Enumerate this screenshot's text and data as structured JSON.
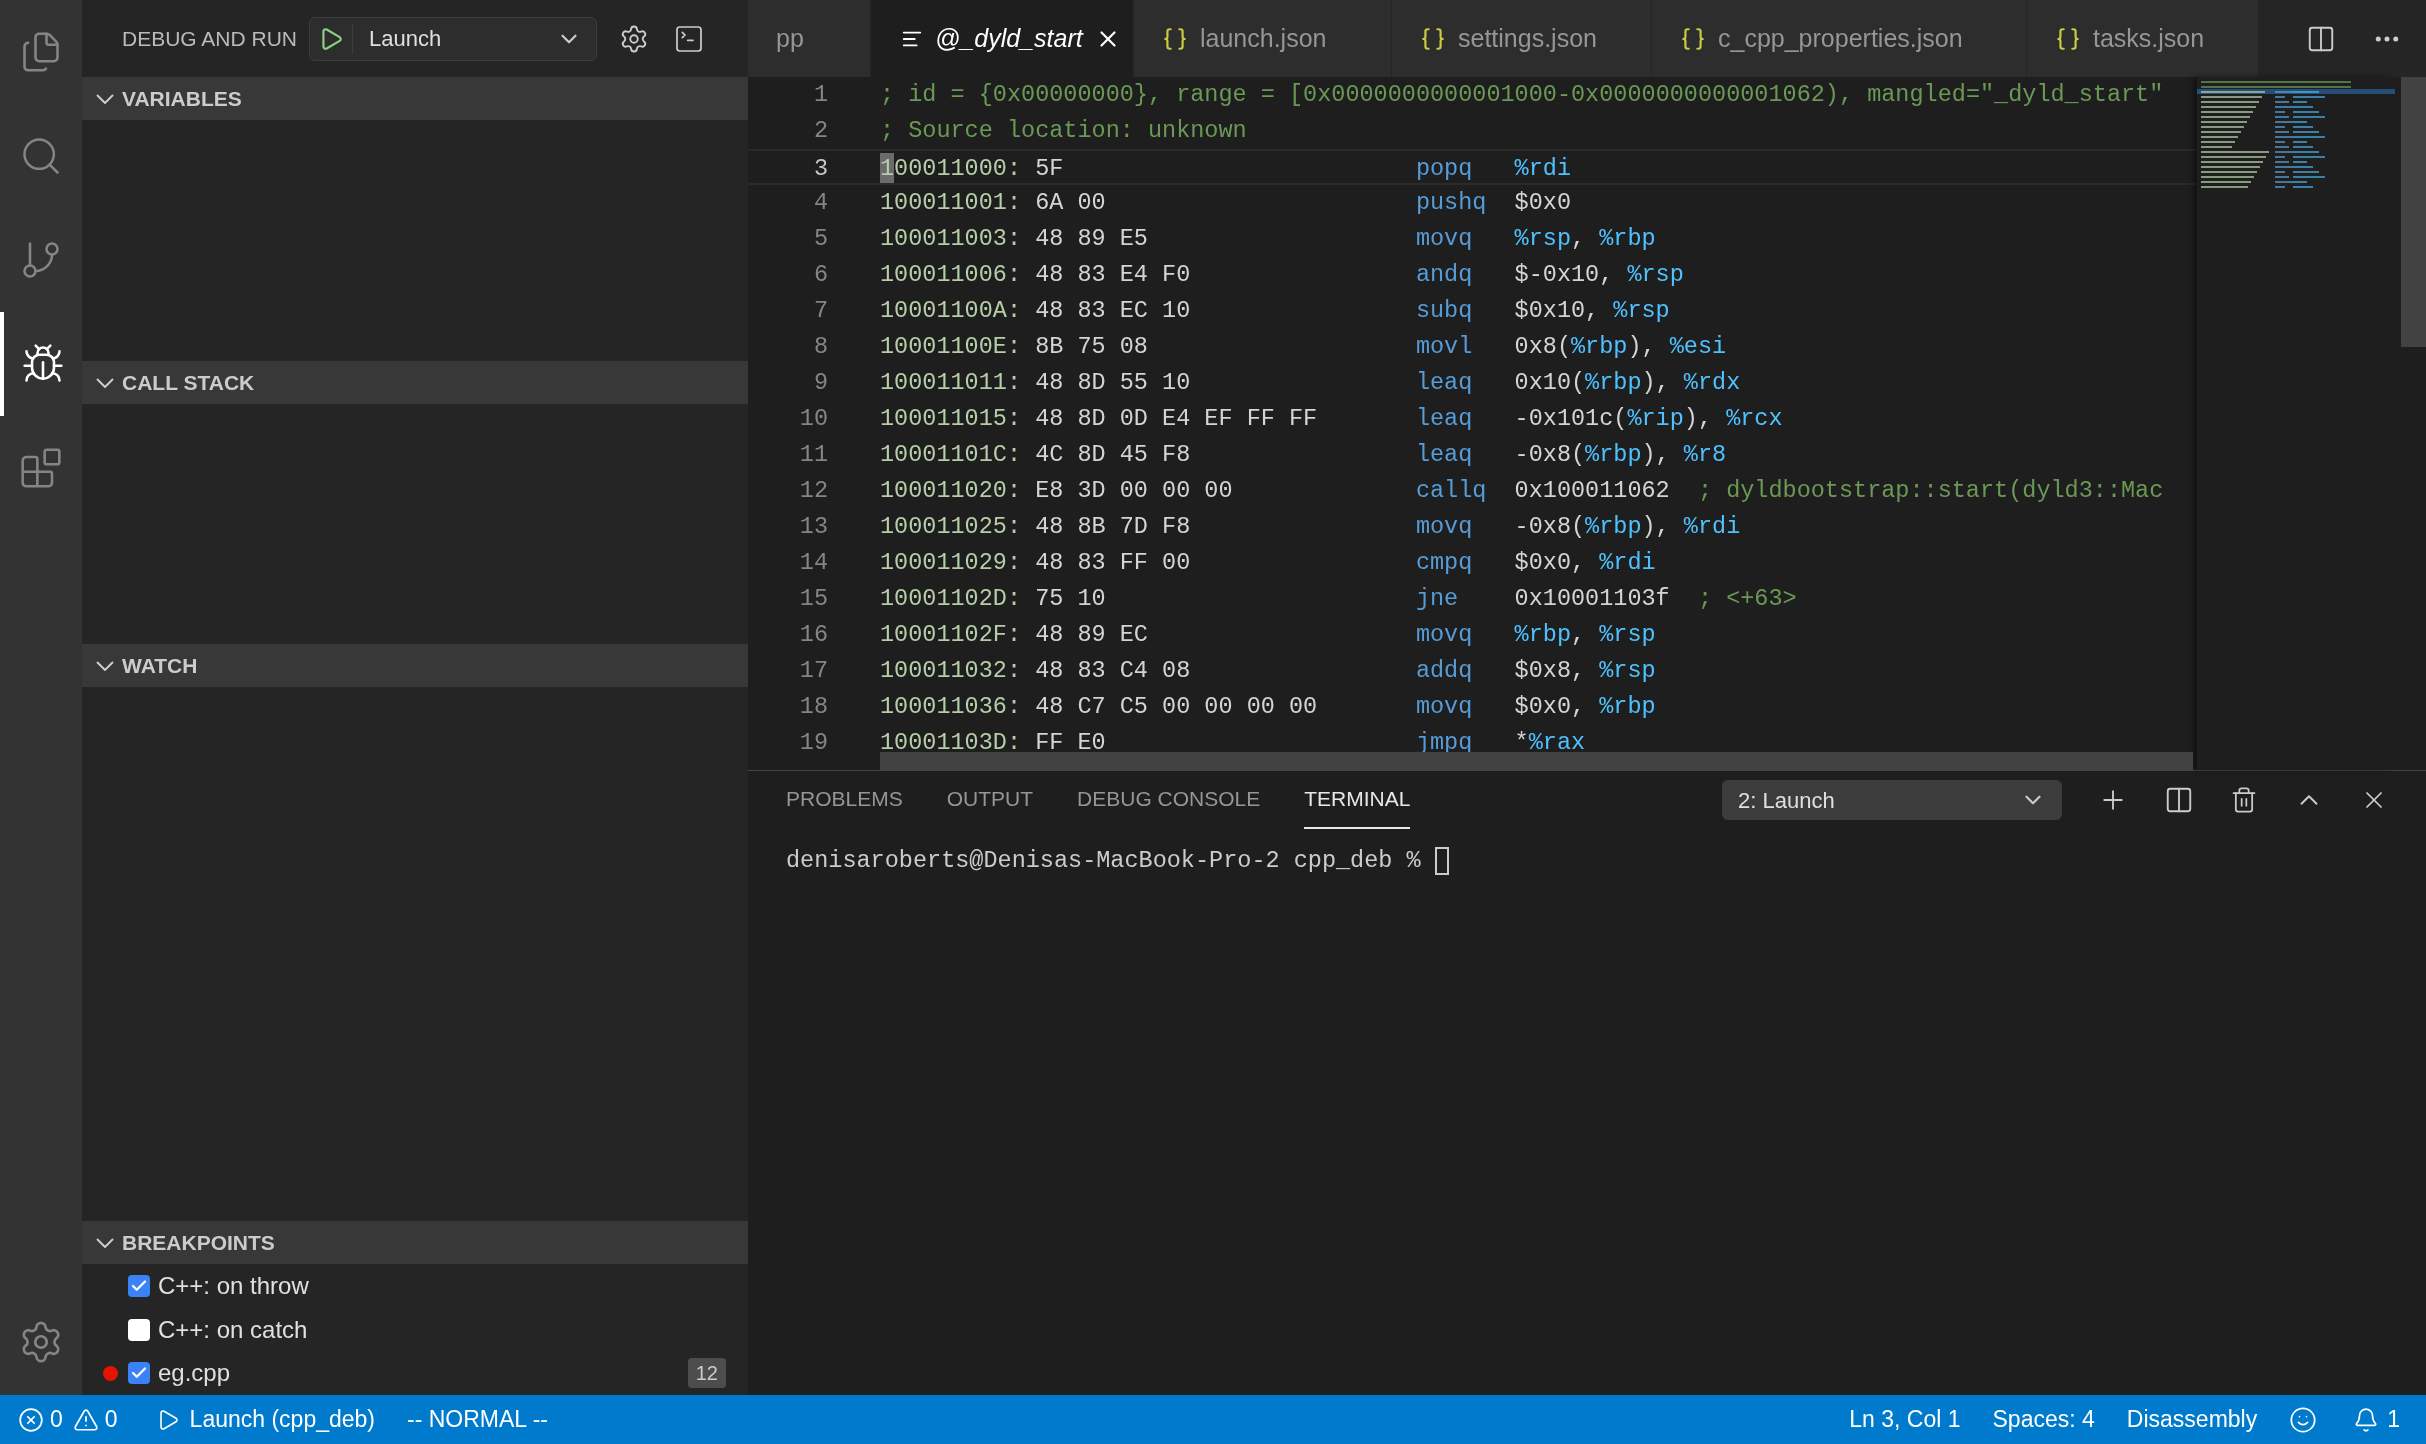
{
  "activity_bar": {
    "items": [
      {
        "kind": "files",
        "selected": false
      },
      {
        "kind": "search",
        "selected": false
      },
      {
        "kind": "source-control",
        "selected": false
      },
      {
        "kind": "debug",
        "selected": true
      },
      {
        "kind": "extensions",
        "selected": false
      }
    ]
  },
  "sidebar": {
    "title": "DEBUG AND RUN",
    "configuration": "Launch",
    "sections": [
      {
        "title": "VARIABLES",
        "expanded": true
      },
      {
        "title": "CALL STACK",
        "expanded": true
      },
      {
        "title": "WATCH",
        "expanded": true
      },
      {
        "title": "BREAKPOINTS",
        "expanded": true,
        "items": [
          {
            "kind": "exception",
            "label": "C++: on throw",
            "checked": true
          },
          {
            "kind": "exception",
            "label": "C++: on catch",
            "checked": false
          },
          {
            "kind": "source",
            "label": "eg.cpp",
            "checked": true,
            "line": "12"
          }
        ]
      }
    ]
  },
  "tabs": [
    {
      "kind": "cpp",
      "label": "pp",
      "selected": false
    },
    {
      "kind": "disassembly",
      "label": "@_dyld_start",
      "selected": true
    },
    {
      "kind": "json",
      "label": "launch.json",
      "selected": false
    },
    {
      "kind": "json",
      "label": "settings.json",
      "selected": false
    },
    {
      "kind": "json",
      "label": "c_cpp_properties.json",
      "selected": false
    },
    {
      "kind": "json",
      "label": "tasks.json",
      "selected": false
    }
  ],
  "editor": {
    "lines": [
      {
        "number": "1",
        "kind": "comment",
        "text": "; id = {0x00000000}, range = [0x0000000000001000-0x0000000000001062), mangled=\"_dyld_start\"",
        "current": false
      },
      {
        "number": "2",
        "kind": "comment",
        "text": "; Source location: unknown",
        "current": false
      },
      {
        "number": "3",
        "kind": "instruction",
        "address": "100011000:",
        "bytes": "5F",
        "mnemonic": "popq",
        "operands": "%rdi",
        "current": true
      },
      {
        "number": "4",
        "kind": "instruction",
        "address": "100011001:",
        "bytes": "6A 00",
        "mnemonic": "pushq",
        "operands": "$0x0",
        "current": false
      },
      {
        "number": "5",
        "kind": "instruction",
        "address": "100011003:",
        "bytes": "48 89 E5",
        "mnemonic": "movq",
        "operands": "%rsp, %rbp",
        "current": false
      },
      {
        "number": "6",
        "kind": "instruction",
        "address": "100011006:",
        "bytes": "48 83 E4 F0",
        "mnemonic": "andq",
        "operands": "$-0x10, %rsp",
        "current": false
      },
      {
        "number": "7",
        "kind": "instruction",
        "address": "10001100A:",
        "bytes": "48 83 EC 10",
        "mnemonic": "subq",
        "operands": "$0x10, %rsp",
        "current": false
      },
      {
        "number": "8",
        "kind": "instruction",
        "address": "10001100E:",
        "bytes": "8B 75 08",
        "mnemonic": "movl",
        "operands": "0x8(%rbp), %esi",
        "current": false
      },
      {
        "number": "9",
        "kind": "instruction",
        "address": "100011011:",
        "bytes": "48 8D 55 10",
        "mnemonic": "leaq",
        "operands": "0x10(%rbp), %rdx",
        "current": false
      },
      {
        "number": "10",
        "kind": "instruction",
        "address": "100011015:",
        "bytes": "48 8D 0D E4 EF FF FF",
        "mnemonic": "leaq",
        "operands": "-0x101c(%rip), %rcx",
        "current": false
      },
      {
        "number": "11",
        "kind": "instruction",
        "address": "10001101C:",
        "bytes": "4C 8D 45 F8",
        "mnemonic": "leaq",
        "operands": "-0x8(%rbp), %r8",
        "current": false
      },
      {
        "number": "12",
        "kind": "instruction",
        "address": "100011020:",
        "bytes": "E8 3D 00 00 00",
        "mnemonic": "callq",
        "operands": "0x100011062",
        "comment": "; dyldbootstrap::start(dyld3::Mac",
        "current": false
      },
      {
        "number": "13",
        "kind": "instruction",
        "address": "100011025:",
        "bytes": "48 8B 7D F8",
        "mnemonic": "movq",
        "operands": "-0x8(%rbp), %rdi",
        "current": false
      },
      {
        "number": "14",
        "kind": "instruction",
        "address": "100011029:",
        "bytes": "48 83 FF 00",
        "mnemonic": "cmpq",
        "operands": "$0x0, %rdi",
        "current": false
      },
      {
        "number": "15",
        "kind": "instruction",
        "address": "10001102D:",
        "bytes": "75 10",
        "mnemonic": "jne",
        "operands": "0x10001103f",
        "comment": "; <+63>",
        "current": false
      },
      {
        "number": "16",
        "kind": "instruction",
        "address": "10001102F:",
        "bytes": "48 89 EC",
        "mnemonic": "movq",
        "operands": "%rbp, %rsp",
        "current": false
      },
      {
        "number": "17",
        "kind": "instruction",
        "address": "100011032:",
        "bytes": "48 83 C4 08",
        "mnemonic": "addq",
        "operands": "$0x8, %rsp",
        "current": false
      },
      {
        "number": "18",
        "kind": "instruction",
        "address": "100011036:",
        "bytes": "48 C7 C5 00 00 00 00",
        "mnemonic": "movq",
        "operands": "$0x0, %rbp",
        "current": false
      },
      {
        "number": "19",
        "kind": "instruction",
        "address": "10001103D:",
        "bytes": "FF E0",
        "mnemonic": "jmpq",
        "operands": "*%rax",
        "current": false
      }
    ]
  },
  "panel": {
    "tabs": [
      {
        "label": "PROBLEMS",
        "selected": false
      },
      {
        "label": "OUTPUT",
        "selected": false
      },
      {
        "label": "DEBUG CONSOLE",
        "selected": false
      },
      {
        "label": "TERMINAL",
        "selected": true
      }
    ],
    "terminal_select": "2: Launch",
    "terminal_prompt": "denisaroberts@Denisas-MacBook-Pro-2 cpp_deb %"
  },
  "status_bar": {
    "errors": "0",
    "warnings": "0",
    "debug_target": "Launch (cpp_deb)",
    "vim_mode": "-- NORMAL --",
    "position": "Ln 3, Col 1",
    "indentation": "Spaces: 4",
    "language": "Disassembly",
    "notifications": "1"
  }
}
